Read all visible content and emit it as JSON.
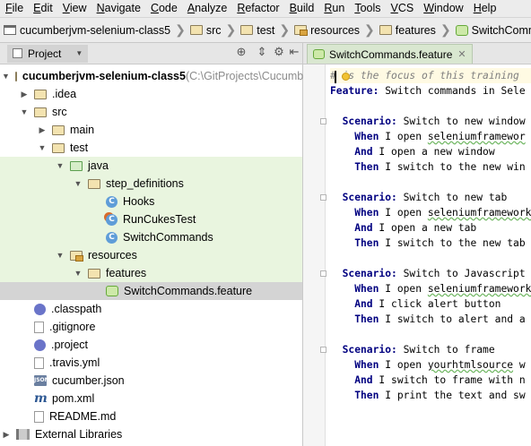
{
  "menu": [
    "File",
    "Edit",
    "View",
    "Navigate",
    "Code",
    "Analyze",
    "Refactor",
    "Build",
    "Run",
    "Tools",
    "VCS",
    "Window",
    "Help"
  ],
  "breadcrumbs": [
    "cucumberjvm-selenium-class5",
    "src",
    "test",
    "resources",
    "features",
    "SwitchCommands.feature"
  ],
  "project_panel": {
    "tab_label": "Project"
  },
  "tree": [
    {
      "label": "cucumberjvm-selenium-class5",
      "path": "(C:\\GitProjects\\Cucumb",
      "icon": "project-folder-icon",
      "arrow": "▼",
      "bold": true
    },
    {
      "label": ".idea",
      "icon": "folder-icon",
      "arrow": "▶"
    },
    {
      "label": "src",
      "icon": "folder-icon",
      "arrow": "▼"
    },
    {
      "label": "main",
      "icon": "folder-icon",
      "arrow": "▶"
    },
    {
      "label": "test",
      "icon": "folder-icon",
      "arrow": "▼"
    },
    {
      "label": "java",
      "icon": "test-source-folder-icon",
      "arrow": "▼"
    },
    {
      "label": "step_definitions",
      "icon": "package-folder-icon",
      "arrow": "▼"
    },
    {
      "label": "Hooks",
      "icon": "class-icon"
    },
    {
      "label": "RunCukesTest",
      "icon": "run-class-icon"
    },
    {
      "label": "SwitchCommands",
      "icon": "class-icon"
    },
    {
      "label": "resources",
      "icon": "resources-folder-icon",
      "arrow": "▼"
    },
    {
      "label": "features",
      "icon": "folder-icon",
      "arrow": "▼"
    },
    {
      "label": "SwitchCommands.feature",
      "icon": "feature-file-icon"
    },
    {
      "label": ".classpath",
      "icon": "classpath-icon"
    },
    {
      "label": ".gitignore",
      "icon": "text-file-icon"
    },
    {
      "label": ".project",
      "icon": "classpath-icon"
    },
    {
      "label": ".travis.yml",
      "icon": "yml-file-icon"
    },
    {
      "label": "cucumber.json",
      "icon": "json-file-icon"
    },
    {
      "label": "pom.xml",
      "icon": "maven-icon"
    },
    {
      "label": "README.md",
      "icon": "text-file-icon"
    },
    {
      "label": "External Libraries",
      "icon": "libraries-icon",
      "arrow": "▶"
    }
  ],
  "editor": {
    "tab_label": "SwitchCommands.feature",
    "lines": [
      {
        "parts": [
          {
            "t": "# is the focus of this training",
            "c": "comment"
          }
        ]
      },
      {
        "parts": [
          {
            "t": "Feature:",
            "c": "kw"
          },
          {
            "t": " Switch commands in Sele",
            "c": ""
          }
        ]
      },
      {
        "parts": []
      },
      {
        "parts": [
          {
            "t": "  Scenario:",
            "c": "kw"
          },
          {
            "t": " Switch to new window",
            "c": ""
          }
        ]
      },
      {
        "parts": [
          {
            "t": "    When",
            "c": "kw"
          },
          {
            "t": " I open ",
            "c": ""
          },
          {
            "t": "seleniumframewor",
            "c": "wavy"
          }
        ]
      },
      {
        "parts": [
          {
            "t": "    And",
            "c": "kw"
          },
          {
            "t": " I open a new window",
            "c": ""
          }
        ]
      },
      {
        "parts": [
          {
            "t": "    Then",
            "c": "kw"
          },
          {
            "t": " I switch to the new win",
            "c": ""
          }
        ]
      },
      {
        "parts": []
      },
      {
        "parts": [
          {
            "t": "  Scenario:",
            "c": "kw"
          },
          {
            "t": " Switch to new tab",
            "c": ""
          }
        ]
      },
      {
        "parts": [
          {
            "t": "    When",
            "c": "kw"
          },
          {
            "t": " I open ",
            "c": ""
          },
          {
            "t": "seleniumframework",
            "c": "wavy"
          }
        ]
      },
      {
        "parts": [
          {
            "t": "    And",
            "c": "kw"
          },
          {
            "t": " I open a new tab",
            "c": ""
          }
        ]
      },
      {
        "parts": [
          {
            "t": "    Then",
            "c": "kw"
          },
          {
            "t": " I switch to the new tab",
            "c": ""
          }
        ]
      },
      {
        "parts": []
      },
      {
        "parts": [
          {
            "t": "  Scenario:",
            "c": "kw"
          },
          {
            "t": " Switch to Javascript",
            "c": ""
          }
        ]
      },
      {
        "parts": [
          {
            "t": "    When",
            "c": "kw"
          },
          {
            "t": " I open ",
            "c": ""
          },
          {
            "t": "seleniumframework",
            "c": "wavy"
          }
        ]
      },
      {
        "parts": [
          {
            "t": "    And",
            "c": "kw"
          },
          {
            "t": " I click alert button",
            "c": ""
          }
        ]
      },
      {
        "parts": [
          {
            "t": "    Then",
            "c": "kw"
          },
          {
            "t": " I switch to alert and a",
            "c": ""
          }
        ]
      },
      {
        "parts": []
      },
      {
        "parts": [
          {
            "t": "  Scenario:",
            "c": "kw"
          },
          {
            "t": " Switch to frame",
            "c": ""
          }
        ]
      },
      {
        "parts": [
          {
            "t": "    When",
            "c": "kw"
          },
          {
            "t": " I open ",
            "c": ""
          },
          {
            "t": "yourhtmlsource",
            "c": "wavy"
          },
          {
            "t": " w",
            "c": ""
          }
        ]
      },
      {
        "parts": [
          {
            "t": "    And",
            "c": "kw"
          },
          {
            "t": " I switch to frame with n",
            "c": ""
          }
        ]
      },
      {
        "parts": [
          {
            "t": "    Then",
            "c": "kw"
          },
          {
            "t": " I print the text and sw",
            "c": ""
          }
        ]
      }
    ]
  }
}
